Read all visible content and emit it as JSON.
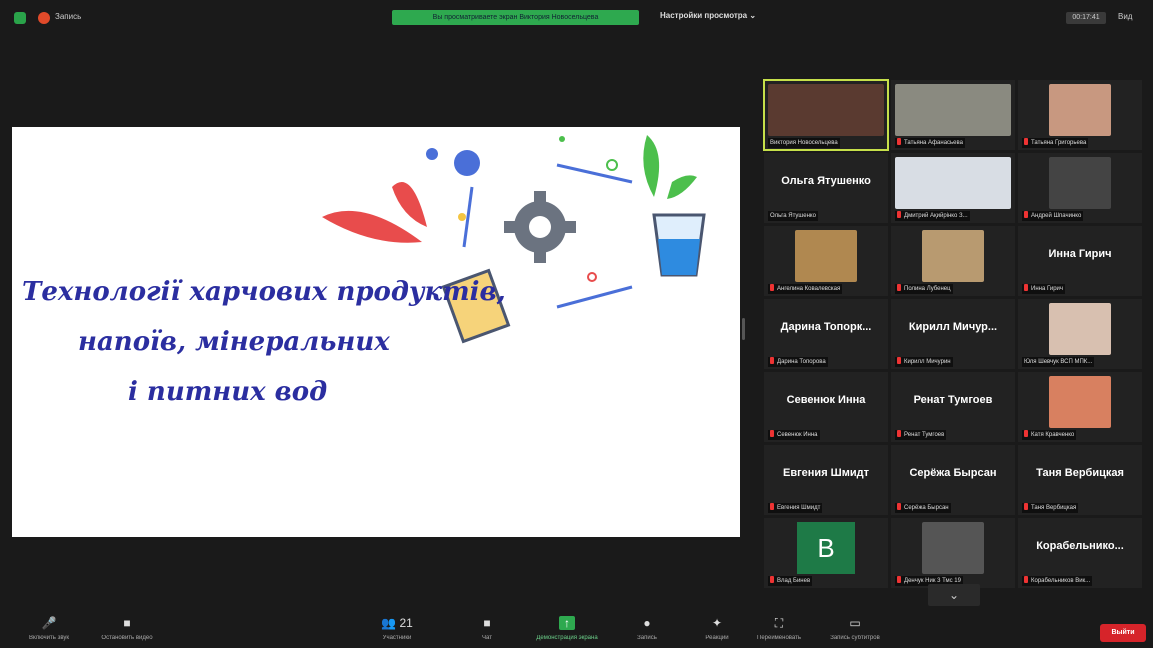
{
  "top_bar": {
    "recording_label": "Запись",
    "share_banner": "Вы просматриваете экран Виктория Новосельцева",
    "view_options": "Настройки просмотра ⌄",
    "timer": "00:17:41",
    "view_label": "Вид"
  },
  "slide": {
    "title_line1": "Технології харчових продуктів,",
    "title_line2": "напоїв, мінеральних",
    "title_line3": "і питних вод"
  },
  "participants": [
    {
      "label": "Виктория Новосельцева",
      "kind": "video",
      "tone": "#5a3a30",
      "active": true,
      "muted": false
    },
    {
      "label": "Татьяна Афанасьева",
      "kind": "video",
      "tone": "#8a8a80",
      "muted": true
    },
    {
      "label": "Татьяна Григорьева",
      "kind": "video-small",
      "tone": "#c89880",
      "muted": true
    },
    {
      "label": "Ольга Ятушенко",
      "display_name": "Ольга Ятушенко",
      "kind": "name",
      "muted": false
    },
    {
      "label": "Дмитрий Ақийрінко З...",
      "kind": "video",
      "tone": "#d8dde4",
      "muted": true
    },
    {
      "label": "Андрей Шпачинко",
      "kind": "video-small",
      "tone": "#444",
      "muted": true
    },
    {
      "label": "Ангелина Ковалевская",
      "kind": "video-small",
      "tone": "#b08850",
      "muted": true
    },
    {
      "label": "Полина Лубенец",
      "kind": "video-small",
      "tone": "#b89a70",
      "muted": true
    },
    {
      "label": "Инна Гирич",
      "display_name": "Инна Гирич",
      "kind": "name",
      "muted": true
    },
    {
      "label": "Дарина Топорова",
      "display_name": "Дарина Топорк...",
      "kind": "name",
      "muted": true
    },
    {
      "label": "Кирилл Мичурин",
      "display_name": "Кирилл Мичур...",
      "kind": "name",
      "muted": true
    },
    {
      "label": "Юля Шевчук ВСП МПК...",
      "kind": "video-small",
      "tone": "#d8c0b0",
      "muted": false
    },
    {
      "label": "Севенюк Инна",
      "display_name": "Севенюк Инна",
      "kind": "name",
      "muted": true
    },
    {
      "label": "Ренат Тумгоев",
      "display_name": "Ренат Тумгоев",
      "kind": "name",
      "muted": true
    },
    {
      "label": "Катя Кравченко",
      "kind": "video-small",
      "tone": "#d88060",
      "muted": true
    },
    {
      "label": "Евгения Шмидт",
      "display_name": "Евгения Шмидт",
      "kind": "name",
      "muted": true
    },
    {
      "label": "Серёжа Бырсан",
      "display_name": "Серёжа Бырсан",
      "kind": "name",
      "muted": true
    },
    {
      "label": "Таня Вербицкая",
      "display_name": "Таня Вербицкая",
      "kind": "name",
      "muted": true
    },
    {
      "label": "Влад Бинев",
      "kind": "avatar",
      "avatar_letter": "B",
      "muted": true
    },
    {
      "label": "Денчук Ник 3 Тмс 19",
      "kind": "video-small",
      "tone": "#555",
      "muted": true
    },
    {
      "label": "Корабельников Вик...",
      "display_name": "Корабельнико...",
      "kind": "name",
      "muted": true
    }
  ],
  "scroll_arrow": "⌄",
  "toolbar": {
    "buttons": [
      {
        "icon": "🎤",
        "icon_name": "mic-muted-icon",
        "label": "Включить звук"
      },
      {
        "icon": "■",
        "icon_name": "video-camera-icon",
        "label": "Остановить видео"
      },
      {
        "icon": "👥 21",
        "icon_name": "participants-icon",
        "label": "Участники"
      },
      {
        "icon": "■",
        "icon_name": "chat-icon",
        "label": "Чат"
      },
      {
        "icon": "↑",
        "icon_name": "share-screen-icon",
        "label": "Демонстрация экрана",
        "green": true
      },
      {
        "icon": "●",
        "icon_name": "record-icon",
        "label": "Запись"
      },
      {
        "icon": "✦",
        "icon_name": "reactions-icon",
        "label": "Реакции"
      },
      {
        "icon": "⛶",
        "icon_name": "rename-icon",
        "label": "Переименовать"
      },
      {
        "icon": "▭",
        "icon_name": "whiteboard-icon",
        "label": "Запись субтитров"
      }
    ],
    "exit_label": "Выйти"
  }
}
